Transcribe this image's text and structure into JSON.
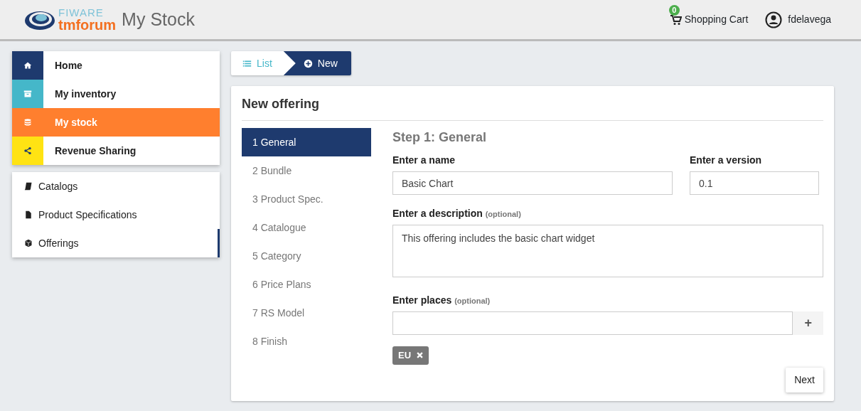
{
  "header": {
    "logo": {
      "top": "FIWARE",
      "bottom": "tmforum"
    },
    "title": "My Stock",
    "cart": {
      "label": "Shopping Cart",
      "count": "0"
    },
    "user": "fdelavega"
  },
  "main_menu": [
    {
      "label": "Home",
      "kind": "home",
      "color": "#1e3a6e",
      "selected": false
    },
    {
      "label": "My inventory",
      "kind": "archive",
      "color": "#45b7c9",
      "selected": false
    },
    {
      "label": "My stock",
      "kind": "database",
      "color": "#ff7f2e",
      "selected": true
    },
    {
      "label": "Revenue Sharing",
      "kind": "share",
      "color": "#ffe313",
      "selected": false
    }
  ],
  "sub_menu": [
    {
      "label": "Catalogs",
      "kind": "book",
      "selected": false
    },
    {
      "label": "Product Specifications",
      "kind": "file",
      "selected": false
    },
    {
      "label": "Offerings",
      "kind": "cube",
      "selected": true
    }
  ],
  "breadcrumb": [
    {
      "label": "List",
      "kind": "list",
      "selected": false
    },
    {
      "label": "New",
      "kind": "plus",
      "selected": true
    }
  ],
  "panel": {
    "title": "New offering",
    "steps": [
      {
        "label": "1 General",
        "selected": true
      },
      {
        "label": "2 Bundle",
        "selected": false
      },
      {
        "label": "3 Product Spec.",
        "selected": false
      },
      {
        "label": "4 Catalogue",
        "selected": false
      },
      {
        "label": "5 Category",
        "selected": false
      },
      {
        "label": "6 Price Plans",
        "selected": false
      },
      {
        "label": "7 RS Model",
        "selected": false
      },
      {
        "label": "8 Finish",
        "selected": false
      }
    ],
    "step_title": "Step 1: General",
    "name": {
      "label": "Enter a name",
      "value": "Basic Chart"
    },
    "version": {
      "label": "Enter a version",
      "value": "0.1"
    },
    "description": {
      "label": "Enter a description",
      "hint": "(optional)",
      "value": "This offering includes the basic chart widget"
    },
    "places": {
      "label": "Enter places",
      "hint": "(optional)",
      "add": "+",
      "tags": [
        "EU"
      ]
    },
    "next": "Next"
  }
}
